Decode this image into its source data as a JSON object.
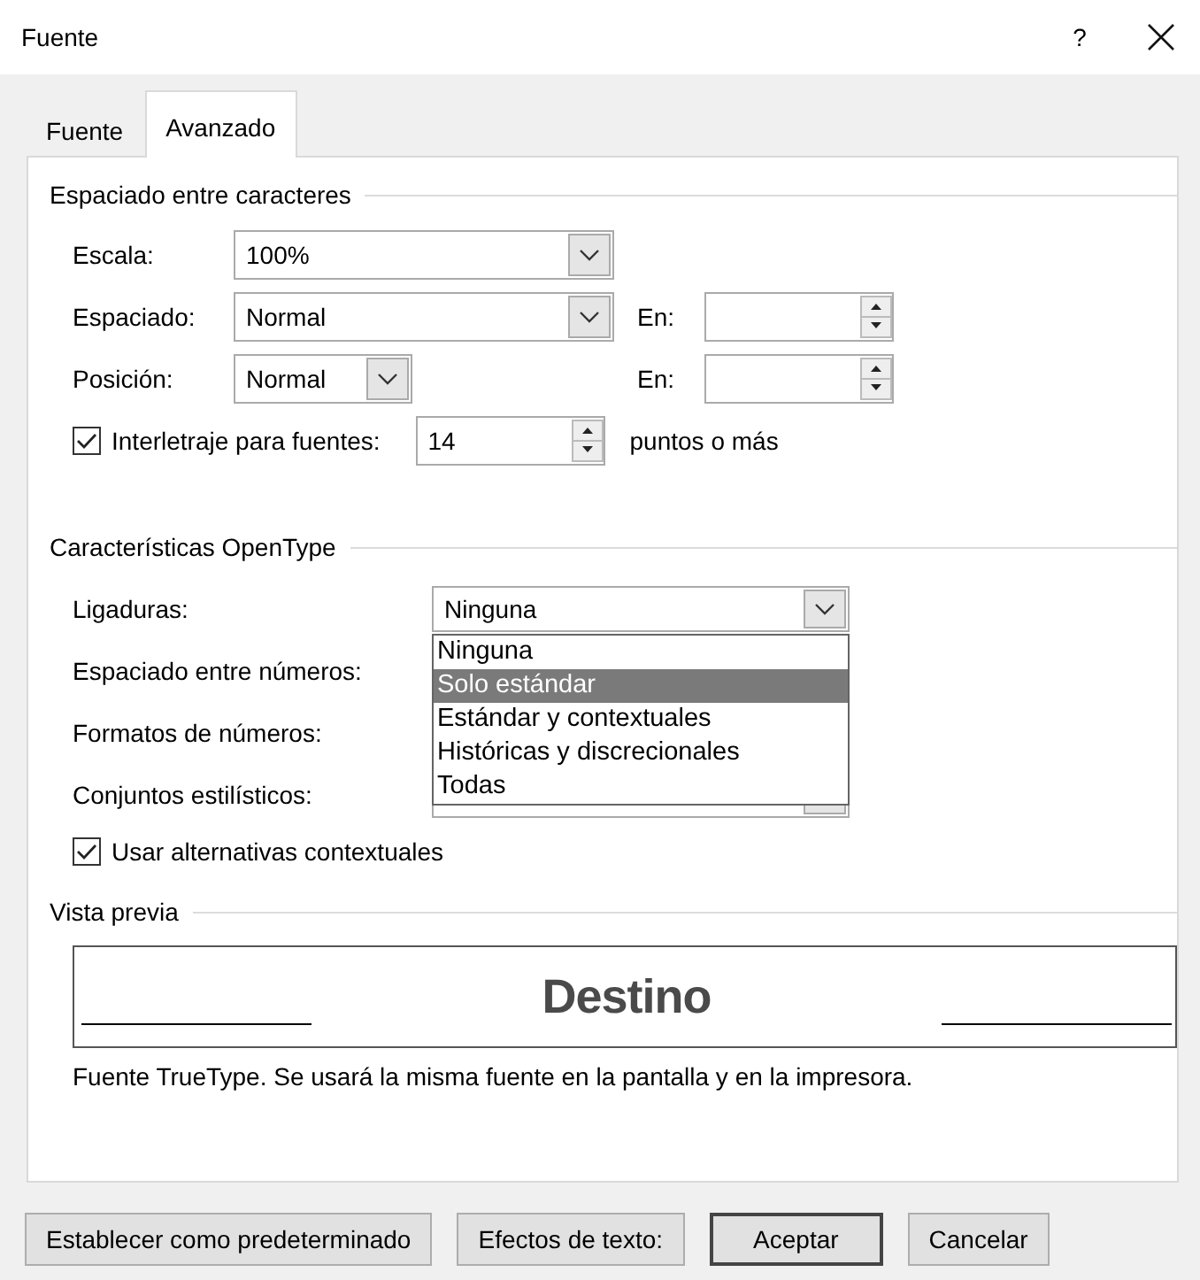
{
  "window": {
    "title": "Fuente",
    "help_label": "?"
  },
  "tabs": [
    {
      "label": "Fuente",
      "selected": false
    },
    {
      "label": "Avanzado",
      "selected": true
    }
  ],
  "character_spacing": {
    "heading": "Espaciado entre caracteres",
    "scale": {
      "label": "Escala:",
      "value": "100%"
    },
    "spacing": {
      "label": "Espaciado:",
      "value": "Normal",
      "by_label": "En:"
    },
    "position": {
      "label": "Posición:",
      "value": "Normal",
      "by_label": "En:"
    },
    "kerning": {
      "label": "Interletraje para fuentes:",
      "checked": true,
      "value": "14",
      "suffix": "puntos o más"
    }
  },
  "opentype": {
    "heading": "Características OpenType",
    "rows": [
      {
        "label": "Ligaduras:",
        "value": "Ninguna",
        "kind": "combo"
      },
      {
        "label": "Espaciado entre números:",
        "kind": "hidden"
      },
      {
        "label": "Formatos de números:",
        "kind": "hidden"
      },
      {
        "label": "Conjuntos estilísticos:",
        "kind": "covered"
      }
    ],
    "open_list": [
      {
        "label": "Ninguna",
        "selected": false
      },
      {
        "label": "Solo estándar",
        "selected": true
      },
      {
        "label": "Estándar y contextuales",
        "selected": false
      },
      {
        "label": "Históricas y discrecionales",
        "selected": false
      },
      {
        "label": "Todas",
        "selected": false
      }
    ],
    "contextual": {
      "label": "Usar alternativas contextuales",
      "checked": true
    }
  },
  "preview": {
    "heading": "Vista previa",
    "sample": "Destino",
    "note": "Fuente TrueType. Se usará la misma fuente en la pantalla y en la impresora."
  },
  "buttons": [
    {
      "label": "Establecer como predeterminado",
      "default": false
    },
    {
      "label": "Efectos de texto:",
      "default": false
    },
    {
      "label": "Aceptar",
      "default": true
    },
    {
      "label": "Cancelar",
      "default": false
    }
  ]
}
